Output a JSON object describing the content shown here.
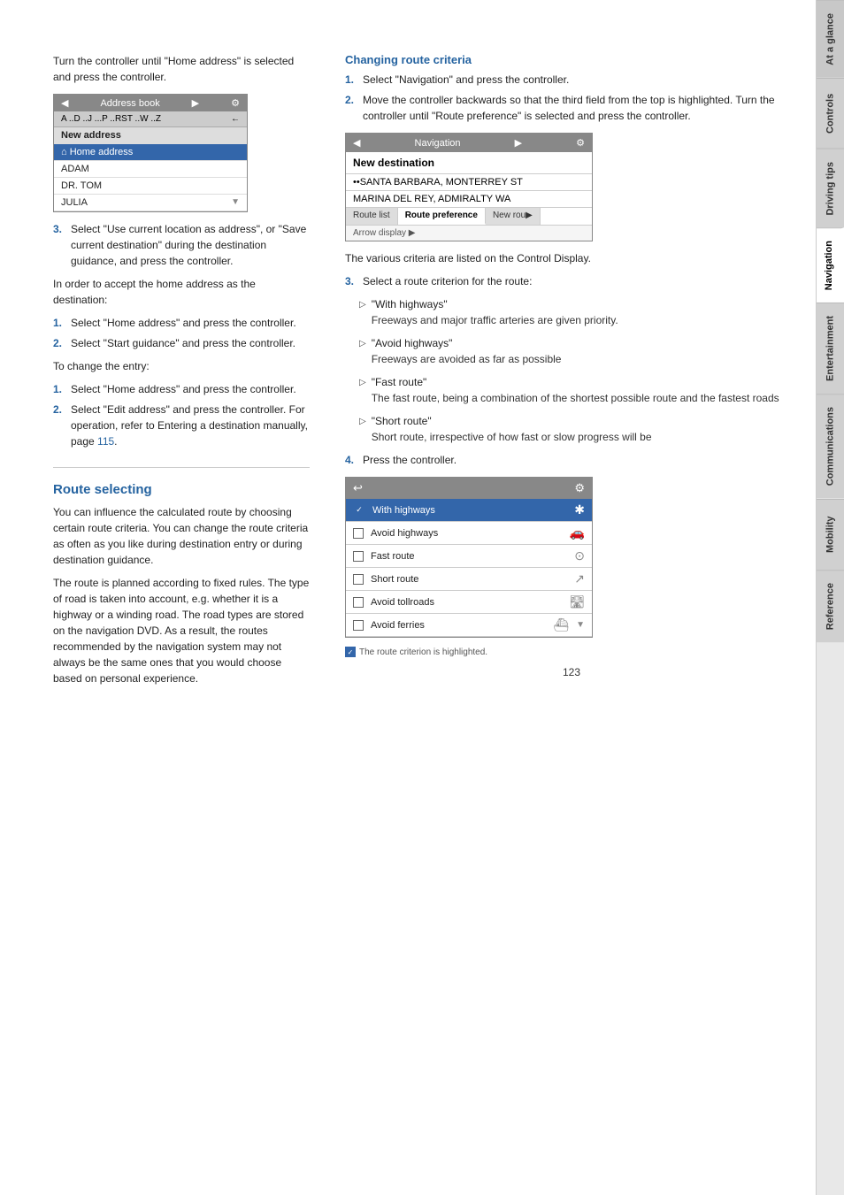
{
  "page": {
    "number": "123"
  },
  "left_column": {
    "intro_text": "Turn the controller until \"Home address\" is selected and press the controller.",
    "address_book": {
      "header": "Address book",
      "alpha_row": "A ..D ..J ...P ..RST ..W ..Z",
      "rows": [
        {
          "label": "New address",
          "type": "normal"
        },
        {
          "label": "Home address",
          "type": "highlight",
          "icon": "🏠"
        },
        {
          "label": "ADAM",
          "type": "normal"
        },
        {
          "label": "DR. TOM",
          "type": "normal"
        },
        {
          "label": "JULIA",
          "type": "normal"
        }
      ]
    },
    "step3_text": "Select \"Use current location as address\", or \"Save current destination\" during the destination guidance, and press the controller.",
    "accept_text": "In order to accept the home address as the destination:",
    "steps_accept": [
      {
        "num": "1.",
        "text": "Select \"Home address\" and press the controller."
      },
      {
        "num": "2.",
        "text": "Select \"Start guidance\" and press the controller."
      }
    ],
    "change_entry_text": "To change the entry:",
    "steps_change": [
      {
        "num": "1.",
        "text": "Select \"Home address\" and press the controller."
      },
      {
        "num": "2.",
        "text": "Select \"Edit address\" and press the controller. For operation, refer to Entering a destination manually, page 115."
      }
    ],
    "route_selecting": {
      "heading": "Route selecting",
      "intro1": "You can influence the calculated route by choosing certain route criteria. You can change the route criteria as often as you like during destination entry or during destination guidance.",
      "intro2": "The route is planned according to fixed rules. The type of road is taken into account, e.g. whether it is a highway or a winding road. The road types are stored on the navigation DVD. As a result, the routes recommended by the navigation system may not always be the same ones that you would choose based on personal experience."
    }
  },
  "right_column": {
    "changing_criteria": {
      "heading": "Changing route criteria",
      "step1": {
        "num": "1.",
        "text": "Select \"Navigation\" and press the controller."
      },
      "step2": {
        "num": "2.",
        "text": "Move the controller backwards so that the third field from the top is highlighted. Turn the controller until \"Route preference\" is selected and press the controller."
      },
      "nav_mockup": {
        "header_left": "Navigation",
        "new_destination": "New destination",
        "dest1": "••SANTA BARBARA, MONTERREY ST",
        "dest2": "MARINA DEL REY, ADMIRALTY WA",
        "tabs": [
          "Route list",
          "Route preference",
          "New rou▶"
        ],
        "active_tab": "Route preference",
        "footer": "Arrow display ▶"
      },
      "display_text": "The various criteria are listed on the Control Display.",
      "step3_text": "Select a route criterion for the route:",
      "criteria": [
        {
          "title": "\"With highways\"",
          "desc": "Freeways and major traffic arteries are given priority."
        },
        {
          "title": "\"Avoid highways\"",
          "desc": "Freeways are avoided as far as possible"
        },
        {
          "title": "\"Fast route\"",
          "desc": "The fast route, being a combination of the shortest possible route and the fastest roads"
        },
        {
          "title": "\"Short route\"",
          "desc": "Short route, irrespective of how fast or slow progress will be"
        }
      ],
      "step4": {
        "num": "4.",
        "text": "Press the controller."
      },
      "route_options": {
        "rows": [
          {
            "label": "With highways",
            "selected": true,
            "icon": "✓"
          },
          {
            "label": "Avoid highways",
            "selected": false,
            "icon": "🚗"
          },
          {
            "label": "Fast route",
            "selected": false,
            "icon": "⏱"
          },
          {
            "label": "Short route",
            "selected": false,
            "icon": "📍"
          },
          {
            "label": "Avoid tollroads",
            "selected": false,
            "icon": "🛣"
          },
          {
            "label": "Avoid ferries",
            "selected": false,
            "icon": "⛴"
          }
        ]
      },
      "caption": "The route criterion is highlighted."
    }
  },
  "sidebar": {
    "tabs": [
      {
        "label": "At a glance"
      },
      {
        "label": "Controls"
      },
      {
        "label": "Driving tips"
      },
      {
        "label": "Navigation"
      },
      {
        "label": "Entertainment"
      },
      {
        "label": "Communications"
      },
      {
        "label": "Mobility"
      },
      {
        "label": "Reference"
      }
    ],
    "active": "Navigation"
  },
  "icons": {
    "arrow_left": "◀",
    "arrow_right": "▶",
    "back": "←",
    "settings": "⚙",
    "home": "⌂",
    "close": "✕",
    "checkmark": "✓",
    "triangle": "▷"
  }
}
